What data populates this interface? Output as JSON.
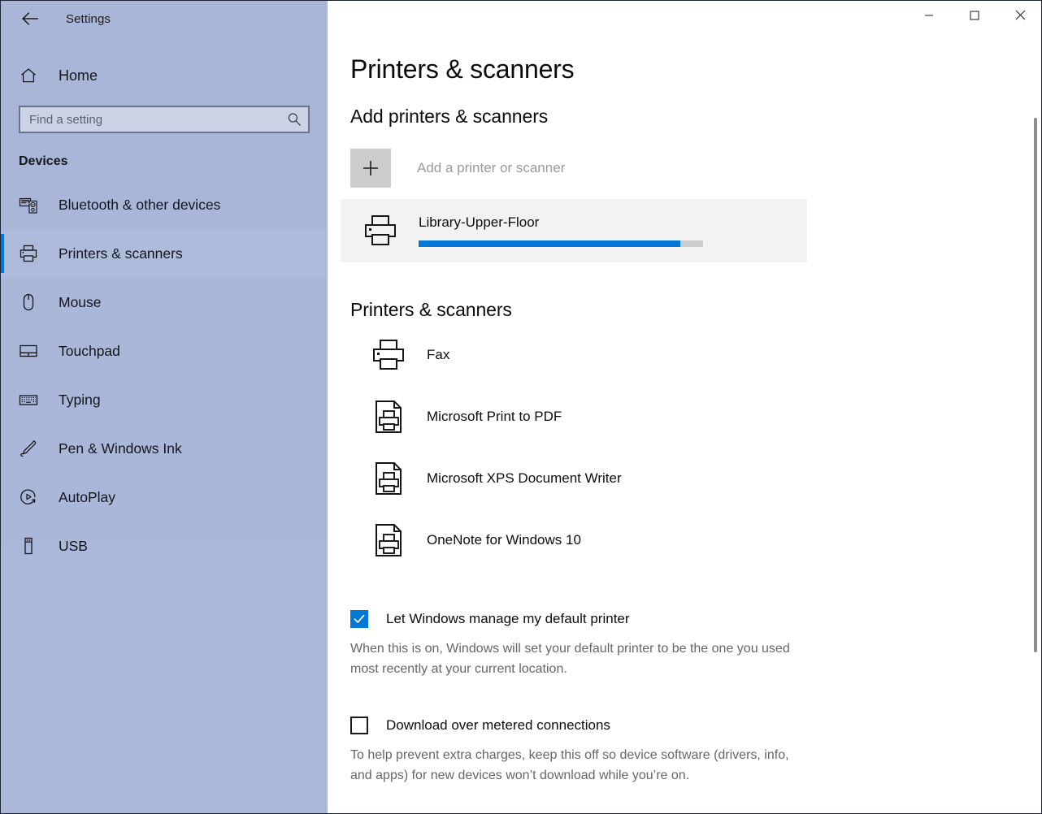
{
  "window": {
    "title": "Settings",
    "back_icon": "back-arrow-icon",
    "minimize_label": "—",
    "maximize_label": "□",
    "close_label": "✕"
  },
  "sidebar": {
    "home_label": "Home",
    "home_icon": "home-icon",
    "search": {
      "placeholder": "Find a setting",
      "value": "",
      "icon": "search-icon"
    },
    "group_heading": "Devices",
    "items": [
      {
        "label": "Bluetooth & other devices",
        "icon": "bluetooth-devices-icon",
        "selected": false
      },
      {
        "label": "Printers & scanners",
        "icon": "printer-icon",
        "selected": true
      },
      {
        "label": "Mouse",
        "icon": "mouse-icon",
        "selected": false
      },
      {
        "label": "Touchpad",
        "icon": "touchpad-icon",
        "selected": false
      },
      {
        "label": "Typing",
        "icon": "keyboard-icon",
        "selected": false
      },
      {
        "label": "Pen & Windows Ink",
        "icon": "pen-icon",
        "selected": false
      },
      {
        "label": "AutoPlay",
        "icon": "autoplay-icon",
        "selected": false
      },
      {
        "label": "USB",
        "icon": "usb-icon",
        "selected": false
      }
    ]
  },
  "main": {
    "page_title": "Printers & scanners",
    "add_section": {
      "heading": "Add printers & scanners",
      "add_button_label": "Add a printer or scanner",
      "add_button_icon": "plus-icon",
      "discovered": {
        "name": "Library-Upper-Floor",
        "icon": "printer-icon",
        "progress_percent": 92
      }
    },
    "list_section": {
      "heading": "Printers & scanners",
      "printers": [
        {
          "name": "Fax",
          "icon": "printer-icon"
        },
        {
          "name": "Microsoft Print to PDF",
          "icon": "document-printer-icon"
        },
        {
          "name": "Microsoft XPS Document Writer",
          "icon": "document-printer-icon"
        },
        {
          "name": "OneNote for Windows 10",
          "icon": "document-printer-icon"
        }
      ]
    },
    "options": [
      {
        "label": "Let Windows manage my default printer",
        "checked": true,
        "description": "When this is on, Windows will set your default printer to be the one you used most recently at your current location."
      },
      {
        "label": "Download over metered connections",
        "checked": false,
        "description": "To help prevent extra charges, keep this off so device software (drivers, info, and apps) for new devices won’t download while you’re on."
      }
    ]
  },
  "colors": {
    "accent": "#0078d7",
    "sidebar_top": "#a9b6d8",
    "sidebar_bottom": "#acb8da",
    "highlight_row": "#f2f2f2",
    "progress_track": "#cccccc"
  }
}
